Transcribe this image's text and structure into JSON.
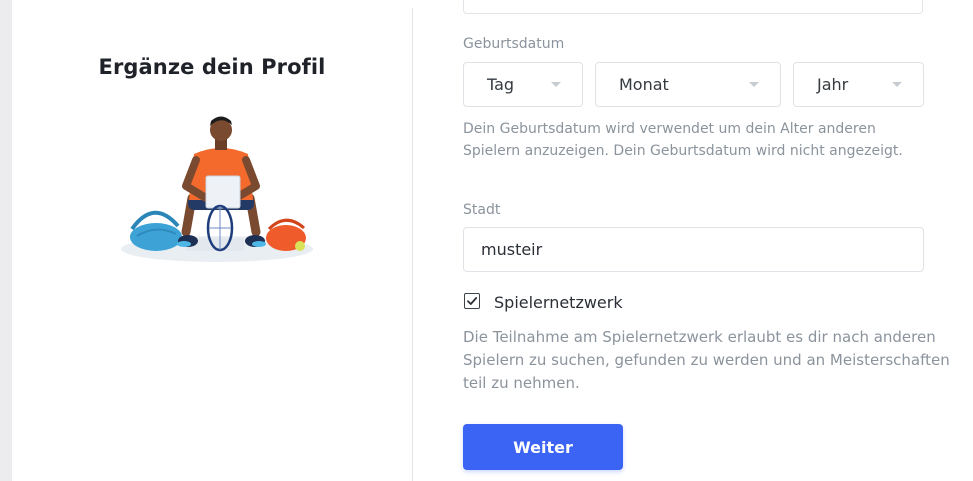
{
  "left": {
    "title": "Ergänze dein Profil",
    "illustration_icon": "tennis-player-illustration"
  },
  "form": {
    "birthdate": {
      "label": "Geburtsdatum",
      "day": "Tag",
      "month": "Monat",
      "year": "Jahr",
      "help": "Dein Geburtsdatum wird verwendet um dein Alter anderen Spielern anzuzeigen. Dein Geburtsdatum wird nicht angezeigt."
    },
    "city": {
      "label": "Stadt",
      "value": "musteir"
    },
    "player_network": {
      "label": "Spielernetzwerk",
      "checked": true,
      "help": "Die Teilnahme am Spielernetzwerk erlaubt es dir nach anderen Spielern zu suchen, gefunden zu werden und an Meisterschaften teil zu nehmen."
    },
    "submit_label": "Weiter"
  },
  "colors": {
    "primary": "#3b63f4",
    "help_text": "#8b939c",
    "border": "#dfe2e6"
  }
}
